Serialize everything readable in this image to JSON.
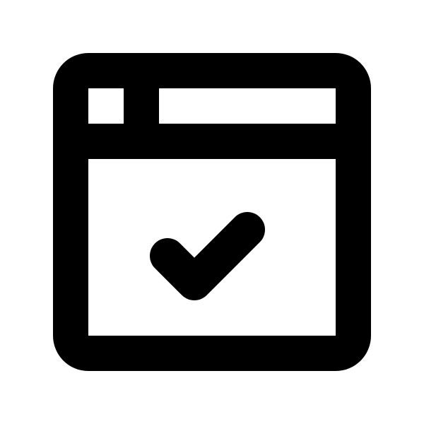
{
  "icon": {
    "name": "browser-window-check-icon",
    "color": "#000000",
    "background": "#ffffff"
  }
}
